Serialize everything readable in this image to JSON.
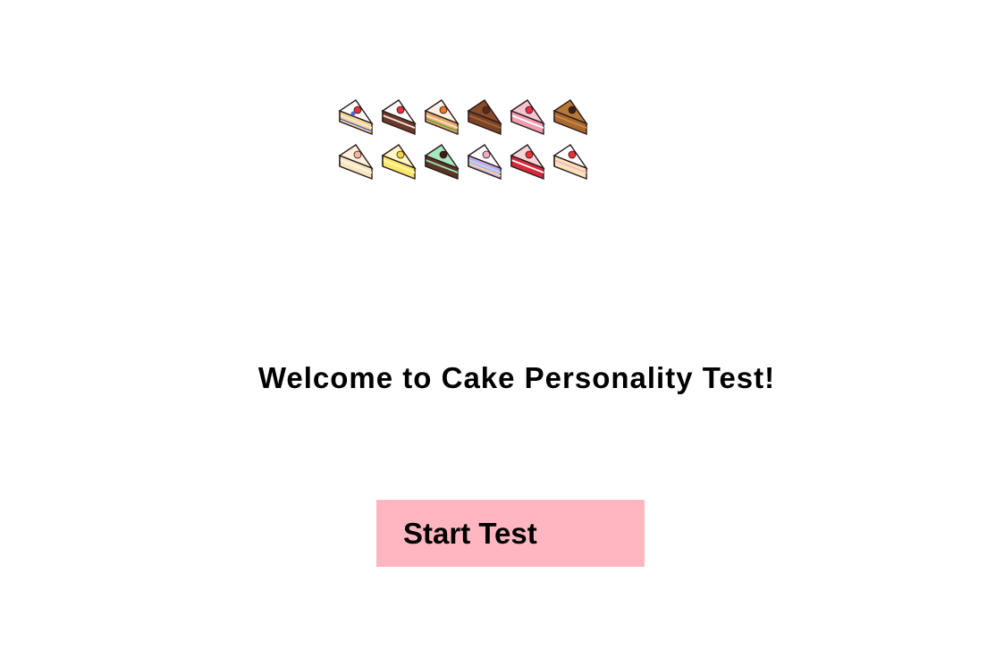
{
  "welcome": {
    "title": "Welcome to Cake Personality Test!"
  },
  "start_button": {
    "label": "Start Test"
  },
  "cakes": [
    {
      "name": "strawberry-vanilla-cake-icon",
      "sponge": "#f6d39a",
      "layer": "#fbe9c8",
      "frosting": "#ffffff",
      "topping": "#e8303a",
      "extra": "#5566cc"
    },
    {
      "name": "black-forest-cake-icon",
      "sponge": "#6b3a2a",
      "layer": "#f4e6dc",
      "frosting": "#ffffff",
      "topping": "#e8303a",
      "extra": ""
    },
    {
      "name": "carrot-cake-icon",
      "sponge": "#e9a96a",
      "layer": "#fbe3c0",
      "frosting": "#fdf3e4",
      "topping": "#e87a2a",
      "extra": "#58a447"
    },
    {
      "name": "chocolate-cake-icon",
      "sponge": "#7a4526",
      "layer": "#a8643c",
      "frosting": "#8a4b2c",
      "topping": "#5a2a14",
      "extra": ""
    },
    {
      "name": "strawberry-cream-cake-icon",
      "sponge": "#f29db0",
      "layer": "#ffffff",
      "frosting": "#f8c4d2",
      "topping": "#e8303a",
      "extra": ""
    },
    {
      "name": "mocha-cake-icon",
      "sponge": "#a8682e",
      "layer": "#c88a4c",
      "frosting": "#b87838",
      "topping": "#3a2010",
      "extra": ""
    },
    {
      "name": "sponge-cake-icon",
      "sponge": "#f8e6c0",
      "layer": "#fff6de",
      "frosting": "#fff2dc",
      "topping": "#f2b8a0",
      "extra": ""
    },
    {
      "name": "lemon-cake-icon",
      "sponge": "#fbe76a",
      "layer": "#fff6b0",
      "frosting": "#fff8c4",
      "topping": "#f3d640",
      "extra": ""
    },
    {
      "name": "mint-chocolate-cake-icon",
      "sponge": "#5a3424",
      "layer": "#9fe0b8",
      "frosting": "#a8e8c0",
      "topping": "#3a2010",
      "extra": ""
    },
    {
      "name": "rainbow-cake-icon",
      "sponge": "#c8a8f0",
      "layer": "#a8e0f0",
      "frosting": "#ffffff",
      "topping": "#f2a8c8",
      "extra": "#fbe76a"
    },
    {
      "name": "red-velvet-cake-icon",
      "sponge": "#d8283a",
      "layer": "#ffffff",
      "frosting": "#f8d4d8",
      "topping": "#e8303a",
      "extra": ""
    },
    {
      "name": "strawberry-shortcake-icon",
      "sponge": "#f8e2b8",
      "layer": "#f8b8c0",
      "frosting": "#ffffff",
      "topping": "#e8303a",
      "extra": ""
    }
  ]
}
